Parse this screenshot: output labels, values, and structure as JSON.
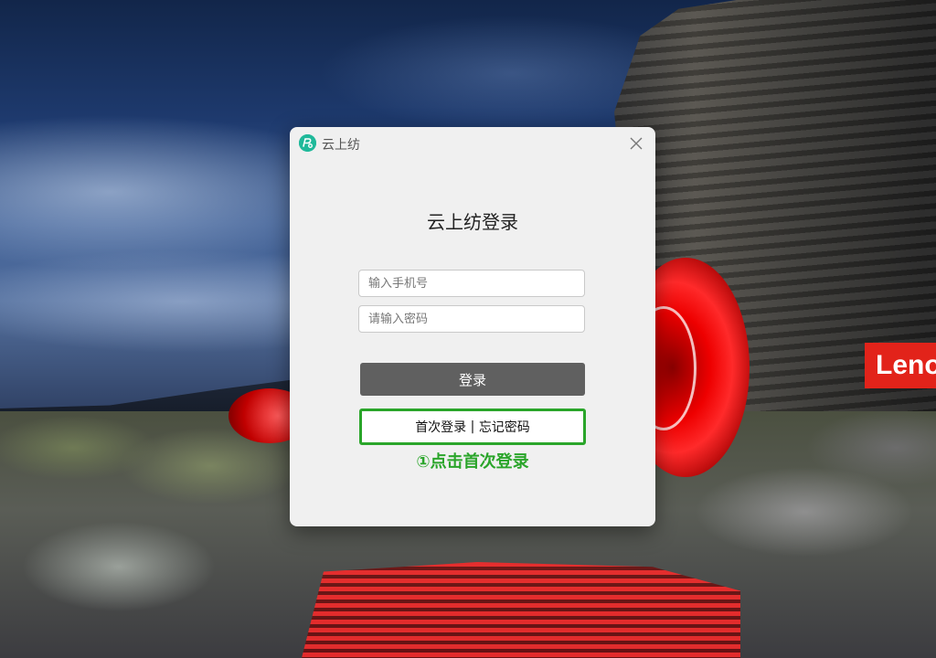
{
  "window": {
    "title": "云上纺",
    "icon": "app-logo-icon"
  },
  "login": {
    "heading": "云上纺登录",
    "phone_placeholder": "输入手机号",
    "password_placeholder": "请输入密码",
    "login_label": "登录",
    "first_login_label": "首次登录",
    "separator": " | ",
    "forgot_password_label": "忘记密码"
  },
  "annotation": {
    "text": "①点击首次登录",
    "color": "#2aa52a"
  },
  "wallpaper": {
    "brand_text": "Lenovo",
    "brand_color": "#e2231a"
  },
  "colors": {
    "dialog_bg": "#f0f0f0",
    "login_button": "#606060",
    "highlight_border": "#2aa52a"
  }
}
